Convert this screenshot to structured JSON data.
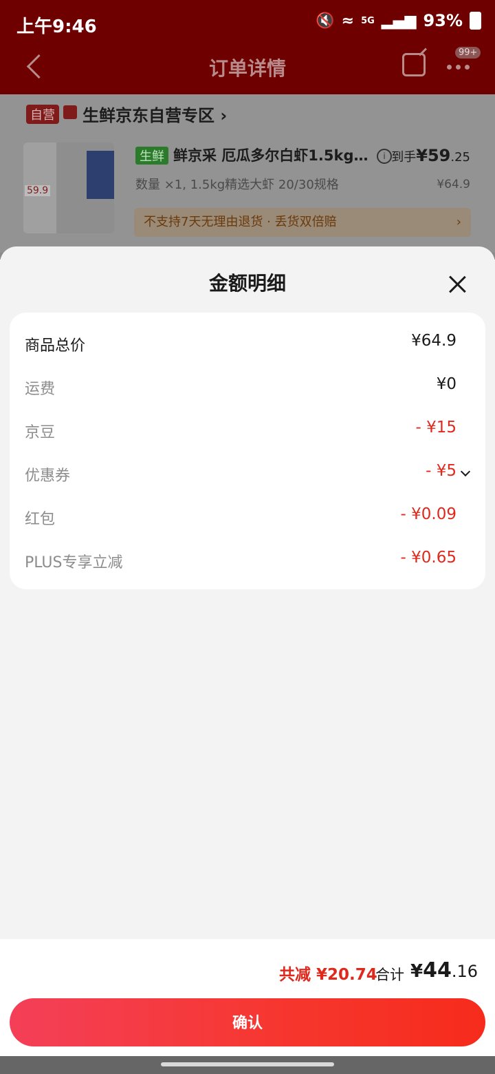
{
  "status_bar": {
    "time": "上午9:46",
    "network": "5G",
    "battery": "93%"
  },
  "nav": {
    "title": "订单详情",
    "more_badge": "99+"
  },
  "order": {
    "self_run_tag": "自营",
    "store_name": "生鲜京东自营专区",
    "fresh_tag": "生鲜",
    "product_title": "鲜京采 厄瓜多尔白虾1.5kg...",
    "product_image_price": "59.9",
    "arrival_label": "到手",
    "arrival_price_main": "¥59",
    "arrival_price_decimal": ".25",
    "spec": "数量 ×1, 1.5kg精选大虾 20/30规格",
    "original_price": "¥64.9",
    "return_note": "不支持7天无理由退货 · 丢货双倍赔"
  },
  "sheet": {
    "title": "金额明细",
    "rows": [
      {
        "label": "商品总价",
        "value": "¥64.9"
      },
      {
        "label": "运费",
        "value": "¥0"
      },
      {
        "label": "京豆",
        "value": "- ¥15"
      },
      {
        "label": "优惠券",
        "value": "- ¥5"
      },
      {
        "label": "红包",
        "value": "- ¥0.09"
      },
      {
        "label": "PLUS专享立减",
        "value": "- ¥0.65"
      }
    ]
  },
  "footer": {
    "savings": "共减 ¥20.74",
    "total_label": "合计",
    "total_currency": "¥",
    "total_int": "44",
    "total_dec": ".16",
    "confirm_label": "确认"
  },
  "colors": {
    "accent_red": "#e0291d",
    "header_red_dimmed": "#6e0000"
  }
}
